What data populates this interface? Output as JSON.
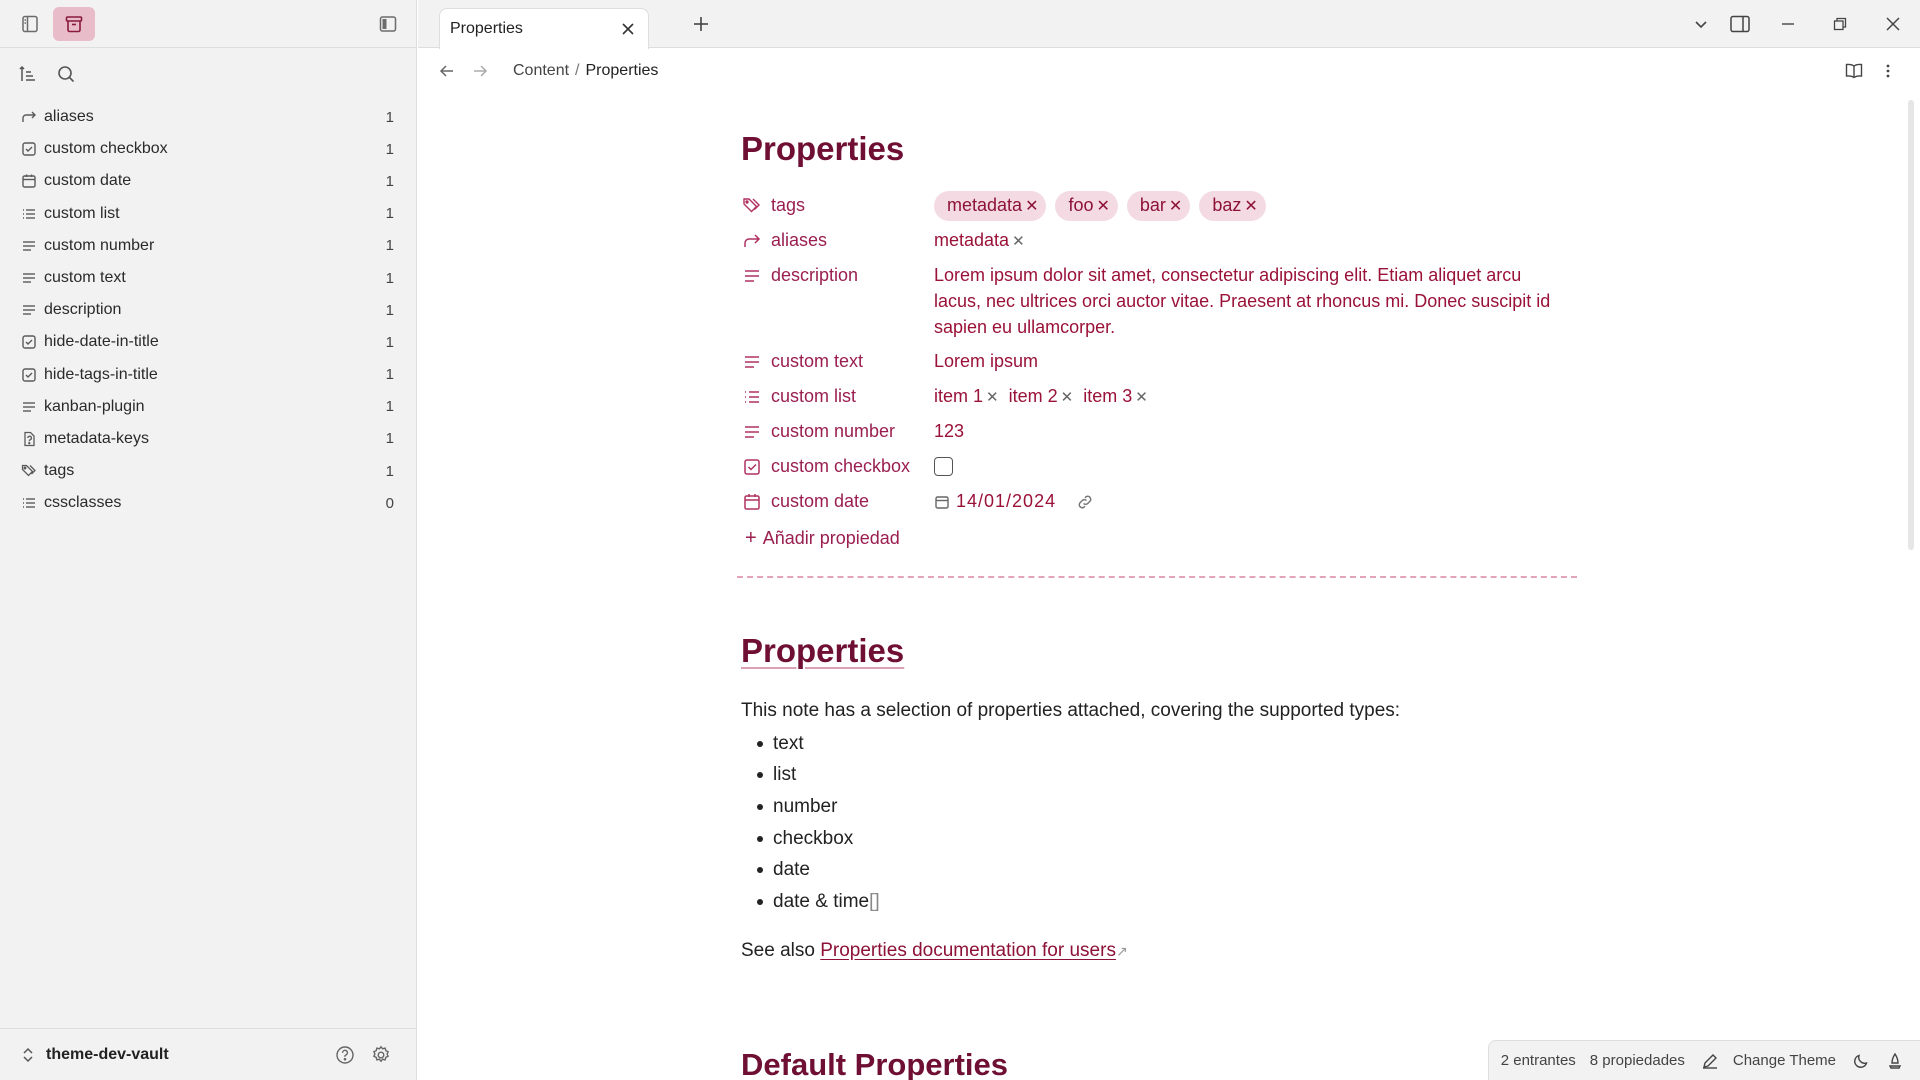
{
  "sidebar": {
    "items": [
      {
        "icon": "arrow-forward-icon",
        "label": "aliases",
        "count": "1"
      },
      {
        "icon": "checkbox-icon",
        "label": "custom checkbox",
        "count": "1"
      },
      {
        "icon": "calendar-icon",
        "label": "custom date",
        "count": "1"
      },
      {
        "icon": "list-icon",
        "label": "custom list",
        "count": "1"
      },
      {
        "icon": "text-lines-icon",
        "label": "custom number",
        "count": "1"
      },
      {
        "icon": "text-lines-icon",
        "label": "custom text",
        "count": "1"
      },
      {
        "icon": "text-lines-icon",
        "label": "description",
        "count": "1"
      },
      {
        "icon": "checkbox-icon",
        "label": "hide-date-in-title",
        "count": "1"
      },
      {
        "icon": "checkbox-icon",
        "label": "hide-tags-in-title",
        "count": "1"
      },
      {
        "icon": "text-lines-icon",
        "label": "kanban-plugin",
        "count": "1"
      },
      {
        "icon": "unknown-type-icon",
        "label": "metadata-keys",
        "count": "1"
      },
      {
        "icon": "tags-icon",
        "label": "tags",
        "count": "1"
      },
      {
        "icon": "list-icon",
        "label": "cssclasses",
        "count": "0"
      }
    ],
    "vault_name": "theme-dev-vault"
  },
  "tabs": [
    {
      "label": "Properties"
    }
  ],
  "breadcrumb": {
    "parent": "Content",
    "separator": "/",
    "current": "Properties"
  },
  "note": {
    "title": "Properties",
    "properties": {
      "tags": {
        "key": "tags",
        "values": [
          "metadata",
          "foo",
          "bar",
          "baz"
        ]
      },
      "aliases": {
        "key": "aliases",
        "values": [
          "metadata"
        ]
      },
      "description": {
        "key": "description",
        "value": "Lorem ipsum dolor sit amet, consectetur adipiscing elit. Etiam aliquet arcu lacus, nec ultrices orci auctor vitae. Praesent at rhoncus mi. Donec suscipit id sapien eu ullamcorper."
      },
      "custom_text": {
        "key": "custom text",
        "value": "Lorem ipsum"
      },
      "custom_list": {
        "key": "custom list",
        "values": [
          "item 1",
          "item 2",
          "item 3"
        ]
      },
      "custom_number": {
        "key": "custom number",
        "value": "123"
      },
      "custom_checkbox": {
        "key": "custom checkbox",
        "checked": false
      },
      "custom_date": {
        "key": "custom date",
        "value": "14/01/2024"
      }
    },
    "add_property_label": "Añadir propiedad",
    "heading": "Properties",
    "intro": "This note has a selection of properties attached, covering the supported types:",
    "types": [
      "text",
      "list",
      "number",
      "checkbox",
      "date",
      "date & time"
    ],
    "types_suffix": "[]",
    "see_also_prefix": "See also",
    "see_also_link": "Properties documentation for users",
    "next_heading": "Default Properties"
  },
  "status": {
    "backlinks": "2 entrantes",
    "properties": "8 propiedades",
    "change_theme": "Change Theme"
  },
  "colors": {
    "accent": "#9a1f50",
    "heading": "#6e0f33",
    "pill_bg": "#f4dbe3"
  }
}
